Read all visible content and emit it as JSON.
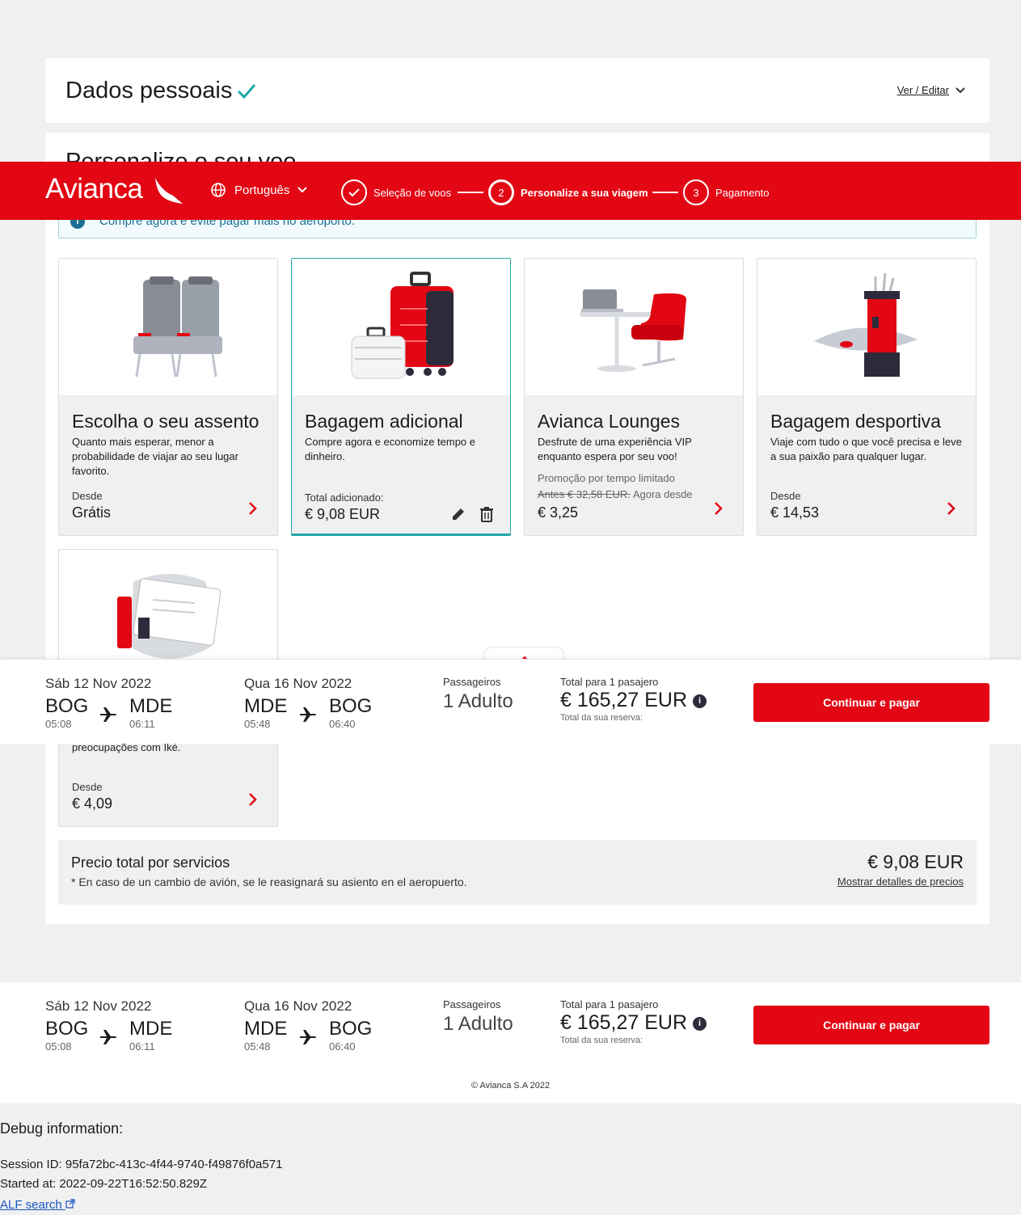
{
  "personal_data": {
    "title": "Dados pessoais",
    "edit_label": "Ver / Editar"
  },
  "personalize": {
    "title": "Personalize o seu voo",
    "info_text": "Compre agora e evite pagar mais no aeroporto."
  },
  "header": {
    "logo": "Avianca",
    "language": "Português",
    "steps": [
      {
        "num": "1",
        "label": "Seleção de voos",
        "state": "done"
      },
      {
        "num": "2",
        "label": "Personalize a sua viagem",
        "state": "active"
      },
      {
        "num": "3",
        "label": "Pagamento",
        "state": "pending"
      }
    ]
  },
  "services": [
    {
      "name": "Escolha o seu assento",
      "desc": "Quanto mais esperar, menor a probabilidade de viajar ao seu lugar favorito.",
      "from_label": "Desde",
      "price": "Grátis"
    },
    {
      "name": "Bagagem adicional",
      "desc": "Compre agora e economize tempo e dinheiro.",
      "from_label": "Total adicionado:",
      "price": "€ 9,08 EUR"
    },
    {
      "name": "Avianca Lounges",
      "desc": "Desfrute de uma experiência VIP enquanto espera por seu voo!",
      "promo": "Promoção por tempo limitado",
      "old_price": "Antes € 32,58 EUR.",
      "now_label": "Agora desde",
      "price": "€ 3,25"
    },
    {
      "name": "Bagagem desportiva",
      "desc": "Viaje com tudo o que você precisa e leve a sua paixão para qualquer lugar.",
      "from_label": "Desde",
      "price": "€ 14,53"
    },
    {
      "name": "",
      "desc": "preocupações com Iké.",
      "from_label": "Desde",
      "price": "€ 4,09"
    }
  ],
  "services_total": {
    "label": "Precio total por servicios",
    "note": "* En caso de un cambio de avión, se le reasignará su asiento en el aeropuerto.",
    "price": "€ 9,08 EUR",
    "details_link": "Mostrar detalles de precios"
  },
  "summary": {
    "outbound": {
      "date": "Sáb 12 Nov 2022",
      "from": "BOG",
      "from_time": "05:08",
      "to": "MDE",
      "to_time": "06:11"
    },
    "inbound": {
      "date": "Qua 16 Nov 2022",
      "from": "MDE",
      "from_time": "05:48",
      "to": "BOG",
      "to_time": "06:40"
    },
    "passengers_label": "Passageiros",
    "passengers": "1 Adulto",
    "total_label": "Total para 1 pasajero",
    "total": "€ 165,27 EUR",
    "total_sub": "Total da sua reserva:",
    "info_icon": "i",
    "button": "Continuar e pagar"
  },
  "footer": {
    "copyright": "© Avianca S.A 2022"
  },
  "debug": {
    "title": "Debug information:",
    "session": "Session ID: 95fa72bc-413c-4f44-9740-f49876f0a571",
    "started": "Started at: 2022-09-22T16:52:50.829Z",
    "link": "ALF search"
  },
  "colors": {
    "brand_red": "#e30613",
    "teal": "#21a6a6",
    "info_blue": "#1d6e96"
  }
}
